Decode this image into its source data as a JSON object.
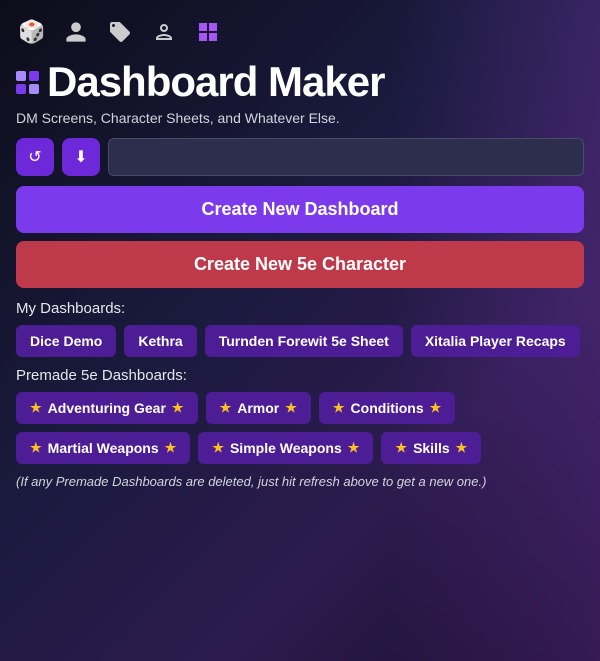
{
  "nav": {
    "icons": [
      {
        "name": "d20-icon",
        "symbol": "🎲"
      },
      {
        "name": "user-icon",
        "symbol": "👤"
      },
      {
        "name": "tag-icon",
        "symbol": "🏷"
      },
      {
        "name": "glasses-icon",
        "symbol": "👓"
      },
      {
        "name": "grid-icon",
        "symbol": "⊞"
      }
    ]
  },
  "header": {
    "title": "Dashboard Maker",
    "subtitle": "DM Screens, Character Sheets, and Whatever Else."
  },
  "toolbar": {
    "refresh_label": "↺",
    "download_label": "⬇",
    "search_placeholder": ""
  },
  "buttons": {
    "create_dashboard": "Create New Dashboard",
    "create_character": "Create New 5e Character"
  },
  "my_dashboards": {
    "label": "My Dashboards:",
    "items": [
      {
        "label": "Dice Demo"
      },
      {
        "label": "Kethra"
      },
      {
        "label": "Turnden Forewit 5e Sheet"
      },
      {
        "label": "Xitalia Player Recaps"
      }
    ]
  },
  "premade_dashboards": {
    "label": "Premade 5e Dashboards:",
    "items": [
      {
        "label": "Adventuring Gear"
      },
      {
        "label": "Armor"
      },
      {
        "label": "Conditions"
      },
      {
        "label": "Martial Weapons"
      },
      {
        "label": "Simple Weapons"
      },
      {
        "label": "Skills"
      }
    ],
    "note": "(If any Premade Dashboards are deleted, just hit refresh above to get a new one.)"
  }
}
